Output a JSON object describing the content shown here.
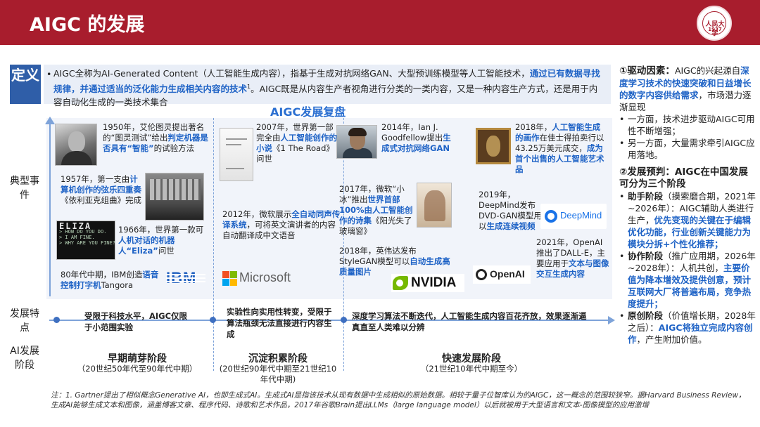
{
  "header": {
    "title": "AIGC 的发展",
    "logo_text": "人民大学",
    "logo_year": "1937"
  },
  "definition": {
    "badge": "定义",
    "bullet": "•",
    "text_1": "AIGC全称为AI-Generated Content（人工智能生成内容），指基于生成对抗网络GAN、大型预训练模型等人工智能技术，",
    "text_hl": "通过已有数据寻找规律，并通过适当的泛化能力生成相关内容的技术",
    "text_sup": "1",
    "text_2": "。AIGC既是从内容生产者视角进行分类的一类内容，又是一种内容生产方式，还是用于内容自动化生成的一类技术集合"
  },
  "review_title": "AIGC发展复盘",
  "row_labels": {
    "events": "典型事件",
    "features": "发展特点",
    "stages": "AI发展阶段"
  },
  "events": {
    "e1950": {
      "p1": "1950年，艾伦图灵提出著名的“图灵测试”给出",
      "b": "判定机器是否具有“智能”",
      "p2": "的试验方法"
    },
    "e1957": {
      "p1": "1957年，第一支由",
      "b": "计算机创作的弦乐四重奏",
      "p2": "《依利亚克组曲》完成"
    },
    "e1966": {
      "p1": "1966年，世界第一款可",
      "b": "人机对话的机器人“Eliza”",
      "p2": "问世"
    },
    "e80s": {
      "p1": "80年代中期，IBM创造",
      "b": "语音控制打字机",
      "p2": "Tangora"
    },
    "e2007": {
      "p1": "2007年，世界第一部完全由",
      "b": "人工智能创作的小说",
      "p2": "《1 The Road》问世"
    },
    "e2012": {
      "p1": "2012年，微软展示",
      "b": "全自动同声传译系统",
      "p2": "，可将英文演讲者的内容自动翻译成中文语音"
    },
    "e2014": {
      "p1": "2014年，Ian J. Goodfellow提出",
      "b": "生成式对抗网络GAN",
      "p2": ""
    },
    "e2017": {
      "p1": "2017年，微软“小冰”推出",
      "b": "世界首部100%由人工智能创作的诗集",
      "p2": "《阳光失了玻璃窗》"
    },
    "e2018n": {
      "p1": "2018年，英伟达发布StyleGAN模型可以",
      "b": "自动生成高质量图片",
      "p2": ""
    },
    "e2018a": {
      "p1": "2018年，",
      "b": "人工智能生成的画作",
      "p2": "在佳士得拍卖行以43.25万美元成交，",
      "b2": "成为首个出售的人工智能艺术品"
    },
    "e2019": {
      "p1": "2019年，DeepMind发布DVD-GAN模型用以",
      "b": "生成连续视频",
      "p2": ""
    },
    "e2021": {
      "p1": "2021年，OpenAI推出了DALL-E，主要应用于",
      "b": "文本与图像交互生成内容",
      "p2": ""
    }
  },
  "photo_text": {
    "eliza": "ELIZA",
    "eliza_lines": "> HOW DO YOU DO.\n> I AM FINE.\n> WHY ARE YOU FINE?"
  },
  "logos": {
    "ibm": "IBM",
    "microsoft": "Microsoft",
    "nvidia": "NVIDIA",
    "openai": "OpenAI",
    "deepmind": "DeepMind"
  },
  "features": {
    "f1": "受限于科技水平，AIGC仅限于小范围实验",
    "f2": "实验性向实用性转变，受限于算法瓶颈无法直接进行内容生成",
    "f3": "深度学习算法不断迭代，人工智能生成内容百花齐放，效果逐渐逼真直至人类难以分辨"
  },
  "stages": [
    {
      "name": "早期萌芽阶段",
      "period": "（20世纪50年代至90年代中期）"
    },
    {
      "name": "沉淀积累阶段",
      "period": "(20世纪90年代中期至21世纪10年代中期)"
    },
    {
      "name": "快速发展阶段",
      "period": "（21世纪10年代中期至今）"
    }
  ],
  "note": "注：1. Gartner提出了相似概念Generative AI，也即生成式AI。生成式AI是指该技术从现有数据中生成相似的原始数据。相较于量子位智库认为的AIGC，这一概念的范围较狭窄。据Harvard Business Review，生成AI能够生成文本和图像，涵盖博客文章、程序代码、诗歌和艺术作品，2017年谷歌Brain提出LLMs（large language model）以后就被用于大型语言和文本-图像模型的应用激增",
  "right": {
    "h1_bold": "①驱动因素：",
    "h1_text": "AIGC的兴起源自",
    "h1_hl": "深度学习技术的快速突破和日益增长的数字内容供给需求",
    "h1_tail": "，市场潜力逐渐显现",
    "b1": "一方面，技术进步驱动AIGC可用性不断增强；",
    "b2": "另一方面，大量需求牵引AIGC应用落地。",
    "h2": "②发展预判：AIGC在中国发展可分为三个阶段",
    "s1_k": "助手阶段",
    "s1_t": "（摸索磨合期，2021年~2026年）：AIGC辅助人类进行生产，",
    "s1_hl": "优先变现的关键在于编辑优化功能，行业创新关键能力为模块分拆+个性化推荐；",
    "s2_k": "协作阶段",
    "s2_t": "（推广应用期，2026年~2028年）：人机共创，",
    "s2_hl": "主要价值为降本增效及提供创意，预计互联网大厂将普遍布局，竞争热度提升；",
    "s3_k": "原创阶段",
    "s3_t": "（价值增长期，2028年之后）：",
    "s3_hl": "AIGC将独立完成内容创作",
    "s3_tail": "，产生附加价值。"
  },
  "colors": {
    "header": "#a81d2d",
    "accent_blue": "#1f63c6",
    "panel": "#f1f4fa"
  }
}
